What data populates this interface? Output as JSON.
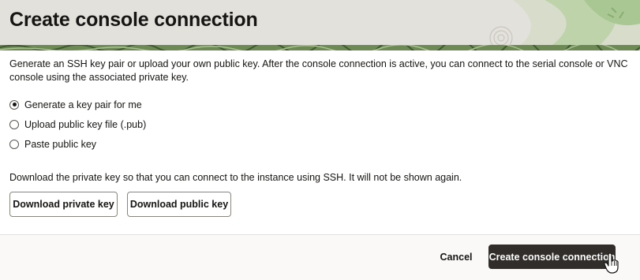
{
  "panel": {
    "title": "Create console connection"
  },
  "body": {
    "intro": "Generate an SSH key pair or upload your own public key. After the console connection is active, you can connect to the serial console or VNC console using the associated private key.",
    "key_options": [
      {
        "label": "Generate a key pair for me",
        "selected": true
      },
      {
        "label": "Upload public key file (.pub)",
        "selected": false
      },
      {
        "label": "Paste public key",
        "selected": false
      }
    ],
    "download_note": "Download the private key so that you can connect to the instance using SSH. It will not be shown again.",
    "download_private_label": "Download private key",
    "download_public_label": "Download public key"
  },
  "footer": {
    "cancel_label": "Cancel",
    "create_label": "Create console connection"
  },
  "colors": {
    "header_bg": "#e3e1dc",
    "primary_button": "#312d2a",
    "text": "#161513",
    "leaf_green": "#b9cfa3",
    "band_dark": "#4d6b3a"
  },
  "icons": {
    "cursor": "hand-pointer-icon",
    "radio": "radio-button-icon"
  }
}
